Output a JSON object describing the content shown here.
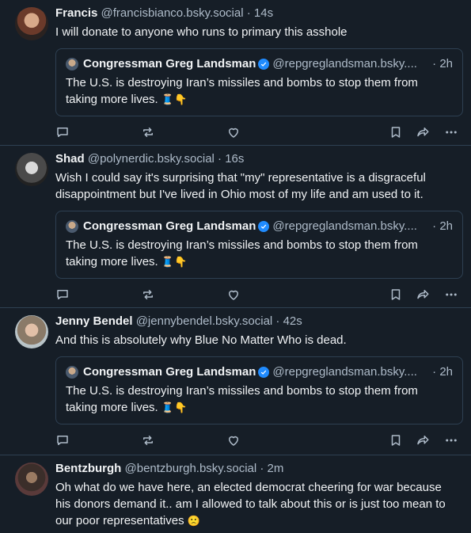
{
  "posts": [
    {
      "name": "Francis",
      "handle": "@francisbianco.bsky.social",
      "time": "14s",
      "text": "I will donate to anyone who runs to primary this asshole",
      "quote": {
        "name": "Congressman Greg Landsman",
        "handle": "@repgreglandsman.bsky....",
        "time": "2h",
        "text": "The U.S. is destroying Iran’s missiles and bombs to stop them from taking more lives.",
        "emoji": "🧵👇"
      }
    },
    {
      "name": "Shad",
      "handle": "@polynerdic.bsky.social",
      "time": "16s",
      "text": "Wish I could say it's surprising that \"my\" representative is a disgraceful disappointment but I've lived in Ohio most of my life and am used to it.",
      "quote": {
        "name": "Congressman Greg Landsman",
        "handle": "@repgreglandsman.bsky....",
        "time": "2h",
        "text": "The U.S. is destroying Iran’s missiles and bombs to stop them from taking more lives.",
        "emoji": "🧵👇"
      }
    },
    {
      "name": "Jenny Bendel",
      "handle": "@jennybendel.bsky.social",
      "time": "42s",
      "text": "And this is absolutely why Blue No Matter Who is dead.",
      "quote": {
        "name": "Congressman Greg Landsman",
        "handle": "@repgreglandsman.bsky....",
        "time": "2h",
        "text": "The U.S. is destroying Iran’s missiles and bombs to stop them from taking more lives.",
        "emoji": "🧵👇"
      }
    },
    {
      "name": "Bentzburgh",
      "handle": "@bentzburgh.bsky.social",
      "time": "2m",
      "text": "Oh what do we have here, an elected democrat cheering for war because his donors demand it.. am I allowed to talk about this or is just too mean to our poor representatives",
      "emoji": "🙁"
    }
  ],
  "separator": "·",
  "icons": [
    "reply-icon",
    "repost-icon",
    "like-icon",
    "bookmark-icon",
    "share-icon",
    "more-icon"
  ],
  "colors": {
    "background": "#161e27",
    "muted": "#aebbc9",
    "border": "#2e4052",
    "verified": "#208bfe"
  }
}
